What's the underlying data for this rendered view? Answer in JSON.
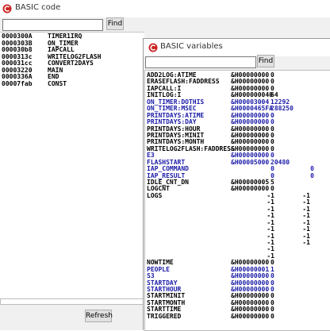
{
  "code_window": {
    "title": "BASIC code",
    "find_label": "Find",
    "refresh_label": "Refresh",
    "rows": [
      {
        "addr": "0000300A",
        "name": "TIMER1IRQ"
      },
      {
        "addr": "0000303B",
        "name": "ON_TIMER"
      },
      {
        "addr": "000030b8",
        "name": "IAPCALL"
      },
      {
        "addr": "0000313c",
        "name": "WRITELOG2FLASH"
      },
      {
        "addr": "000031cc",
        "name": "CONVERT2DAYS"
      },
      {
        "addr": "00003220",
        "name": "MAIN"
      },
      {
        "addr": "0000336A",
        "name": "END"
      },
      {
        "addr": "00007fab",
        "name": "CONST"
      }
    ]
  },
  "vars_window": {
    "title": "BASIC variables",
    "find_label": "Find",
    "rows": [
      {
        "name": "ADD2LOG:ATIME",
        "addr": "&H00000000",
        "val": "0",
        "blue": false
      },
      {
        "name": "ERASEFLASH:FADDRESS",
        "addr": "&H00000000",
        "val": "0",
        "blue": false
      },
      {
        "name": "IAPCALL:I",
        "addr": "&H00000000",
        "val": "0",
        "blue": false
      },
      {
        "name": "INITLOG:I",
        "addr": "&H000000040",
        "val": "64",
        "blue": false
      },
      {
        "name": "ON_TIMER:DOTHIS",
        "addr": "&H00003004",
        "val": "12292",
        "blue": true
      },
      {
        "name": "ON_TIMER:MSEC",
        "addr": "&H0000465FA",
        "val": "288250",
        "blue": true
      },
      {
        "name": "PRINTDAYS:ATIME",
        "addr": "&H00000000",
        "val": "0",
        "blue": true
      },
      {
        "name": "PRINTDAYS:DAY",
        "addr": "&H00000000",
        "val": "0",
        "blue": true
      },
      {
        "name": "PRINTDAYS:HOUR",
        "addr": "&H00000000",
        "val": "0",
        "blue": false
      },
      {
        "name": "PRINTDAYS:MINIT",
        "addr": "&H00000000",
        "val": "0",
        "blue": false
      },
      {
        "name": "PRINTDAYS:MONTH",
        "addr": "&H00000000",
        "val": "0",
        "blue": false
      },
      {
        "name": "WRITELOG2FLASH:FADDRESS",
        "addr": "&H00000000",
        "val": "0",
        "blue": false
      },
      {
        "name": "E3",
        "addr": "&H00000000",
        "val": "0",
        "blue": true
      },
      {
        "name": "FLASHSTART",
        "addr": "&H00005000",
        "val": "20480",
        "blue": true
      },
      {
        "name": "IAP_COMMAND",
        "c1": "0",
        "c3": "0",
        "blue": true
      },
      {
        "name": "IAP_RESULT",
        "c1": "0",
        "c3": "0",
        "blue": true
      },
      {
        "name": "IDLE_CNT_DN",
        "addr": "&H00000005",
        "val": "5",
        "blue": false
      },
      {
        "name": "LOGCNT",
        "addr": "&H00000000",
        "val": "0",
        "blue": false
      },
      {
        "name": "LOGS",
        "c1": "-1",
        "c2": "-1",
        "blue": false
      },
      {
        "name": "",
        "c1": "-1",
        "c2": "-1",
        "blue": false
      },
      {
        "name": "",
        "c1": "-1",
        "c2": "-1",
        "blue": false
      },
      {
        "name": "",
        "c1": "-1",
        "c2": "-1",
        "blue": false
      },
      {
        "name": "",
        "c1": "-1",
        "c2": "-1",
        "blue": false
      },
      {
        "name": "",
        "c1": "-1",
        "c2": "-1",
        "blue": false
      },
      {
        "name": "",
        "c1": "-1",
        "c2": "-1",
        "blue": false
      },
      {
        "name": "",
        "c1": "-1",
        "c2": "-1",
        "blue": false
      },
      {
        "name": "",
        "c1": "-1",
        "c2": "",
        "blue": false
      },
      {
        "name": "",
        "c1": "-1",
        "c2": "",
        "blue": false
      },
      {
        "name": "NOWTIME",
        "addr": "&H00000000",
        "val": "0",
        "blue": false
      },
      {
        "name": "PEOPLE",
        "addr": "&H00000001",
        "val": "1",
        "blue": true
      },
      {
        "name": "S3",
        "addr": "&H00000000",
        "val": "0",
        "blue": true
      },
      {
        "name": "STARTDAY",
        "addr": "&H00000000",
        "val": "0",
        "blue": true
      },
      {
        "name": "STARTHOUR",
        "addr": "&H00000000",
        "val": "0",
        "blue": true
      },
      {
        "name": "STARTMINIT",
        "addr": "&H00000000",
        "val": "0",
        "blue": false
      },
      {
        "name": "STARTMONTH",
        "addr": "&H00000000",
        "val": "0",
        "blue": false
      },
      {
        "name": "STARTTIME",
        "addr": "&H00000000",
        "val": "0",
        "blue": false
      },
      {
        "name": "TRIGGERED",
        "addr": "&H00000000",
        "val": "0",
        "blue": false
      }
    ]
  },
  "colors": {
    "app_icon": "#cc2222",
    "variable_highlight": "#1a1aa8"
  }
}
